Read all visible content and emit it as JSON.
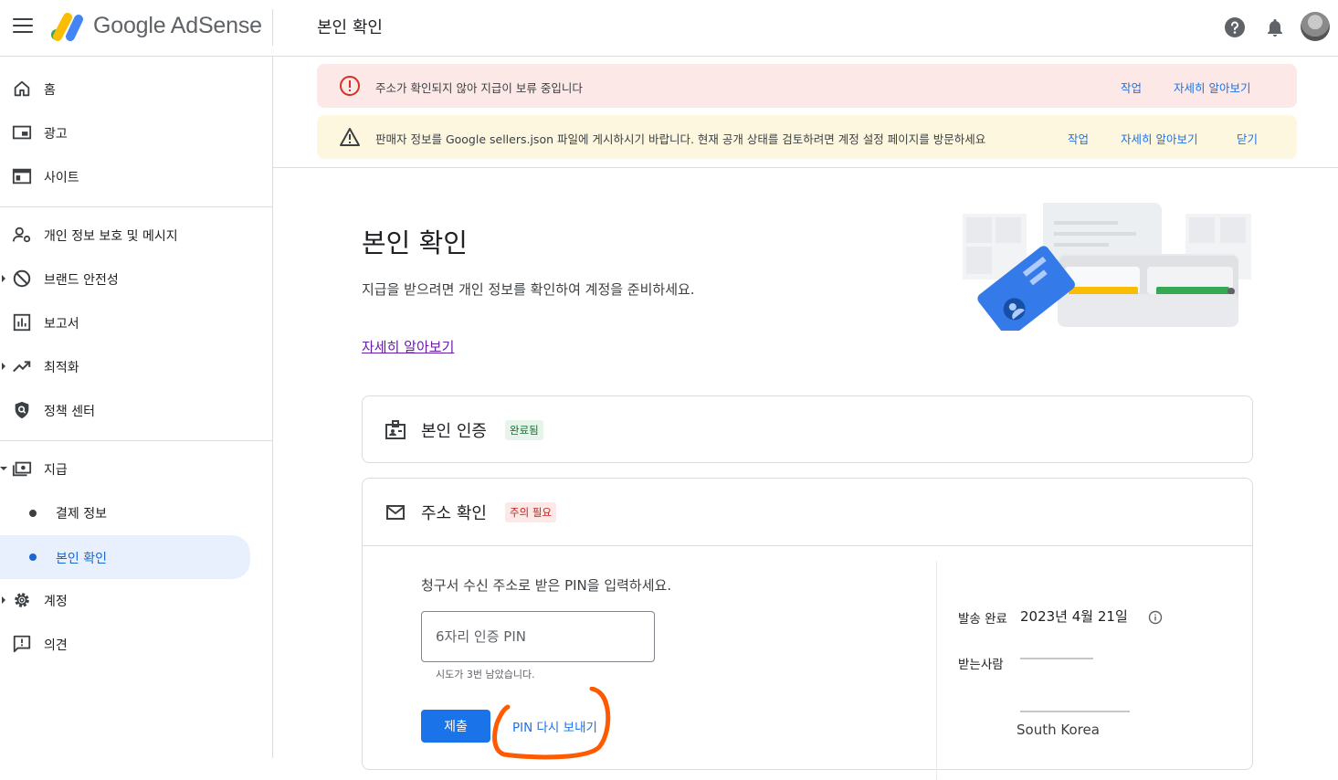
{
  "header": {
    "product_name": "Google AdSense",
    "page_title": "본인 확인"
  },
  "sidebar": {
    "items": [
      {
        "label": "홈",
        "icon": "home-icon"
      },
      {
        "label": "광고",
        "icon": "ads-icon"
      },
      {
        "label": "사이트",
        "icon": "sites-icon"
      },
      {
        "label": "개인 정보 보호 및 메시지",
        "icon": "privacy-icon"
      },
      {
        "label": "브랜드 안전성",
        "icon": "block-icon"
      },
      {
        "label": "보고서",
        "icon": "report-icon"
      },
      {
        "label": "최적화",
        "icon": "trending-icon"
      },
      {
        "label": "정책 센터",
        "icon": "policy-icon"
      },
      {
        "label": "지급",
        "icon": "payments-icon"
      },
      {
        "label": "결제 정보"
      },
      {
        "label": "본인 확인"
      },
      {
        "label": "계정",
        "icon": "gear-icon"
      },
      {
        "label": "의견",
        "icon": "feedback-icon"
      }
    ],
    "active_item": "본인 확인"
  },
  "banners": {
    "error": {
      "text": "주소가 확인되지 않아 지급이 보류 중입니다",
      "action": "작업",
      "learn_more": "자세히 알아보기"
    },
    "warning": {
      "text": "판매자 정보를 Google sellers.json 파일에 게시하시기 바랍니다. 현재 공개 상태를 검토하려면 계정 설정 페이지를 방문하세요",
      "action": "작업",
      "learn_more": "자세히 알아보기",
      "dismiss": "닫기"
    }
  },
  "main": {
    "title": "본인 확인",
    "description": "지급을 받으려면 개인 정보를 확인하여 계정을 준비하세요.",
    "learn_more": "자세히 알아보기",
    "identity_card": {
      "title": "본인 인증",
      "status": "완료됨"
    },
    "address_card": {
      "title": "주소 확인",
      "status": "주의 필요",
      "pin_prompt": "청구서 수신 주소로 받은 PIN을 입력하세요.",
      "pin_placeholder": "6자리 인증 PIN",
      "pin_helper": "시도가 3번 남았습니다.",
      "submit_label": "제출",
      "resend_label": "PIN 다시 보내기",
      "sent_label": "발송 완료",
      "sent_date": "2023년 4월 21일",
      "recipient_label": "받는사람",
      "country": "South Korea"
    }
  },
  "colors": {
    "primary": "#1a73e8",
    "error_bg": "#fce8e6",
    "warning_bg": "#fef7e0",
    "success_chip": "#e6f4ea",
    "annotation": "#ff5a00"
  }
}
